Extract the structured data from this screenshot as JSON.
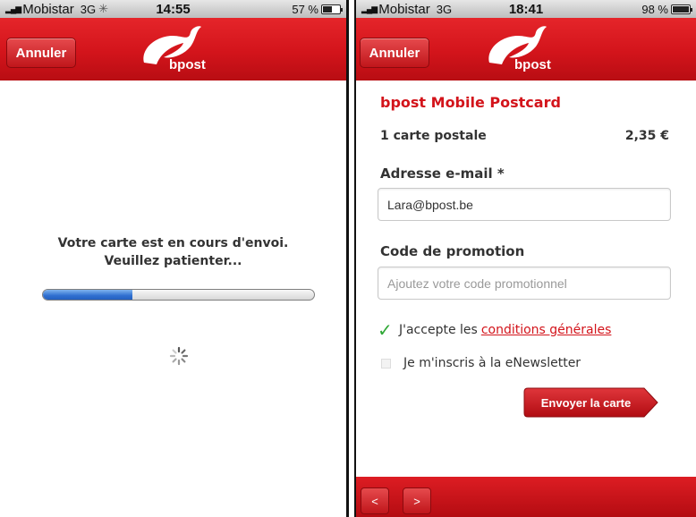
{
  "left_screen": {
    "status": {
      "carrier": "Mobistar",
      "network": "3G",
      "time": "14:55",
      "battery": "57 %",
      "battery_level": 0.57
    },
    "nav": {
      "cancel_label": "Annuler",
      "logo_text": "bpost"
    },
    "message_line1": "Votre carte est en cours d'envoi.",
    "message_line2": "Veuillez patienter...",
    "progress": 0.33
  },
  "right_screen": {
    "status": {
      "carrier": "Mobistar",
      "network": "3G",
      "time": "18:41",
      "battery": "98 %",
      "battery_level": 0.98
    },
    "nav": {
      "cancel_label": "Annuler",
      "logo_text": "bpost"
    },
    "title": "bpost Mobile Postcard",
    "order": {
      "item": "1 carte postale",
      "price": "2,35 €"
    },
    "email": {
      "label": "Adresse e-mail *",
      "value": "Lara@bpost.be"
    },
    "promo": {
      "label": "Code de promotion",
      "placeholder": "Ajoutez votre code promotionnel"
    },
    "terms": {
      "prefix": "J'accepte les",
      "link": "conditions générales",
      "checked": true
    },
    "newsletter": {
      "label": "Je m'inscris à la eNewsletter",
      "checked": false
    },
    "send_label": "Envoyer la carte",
    "bottom_nav": {
      "prev": "<",
      "next": ">"
    }
  },
  "colors": {
    "brand_red": "#d3141b",
    "check_green": "#2fa836",
    "progress_blue": "#2f6fd0"
  }
}
